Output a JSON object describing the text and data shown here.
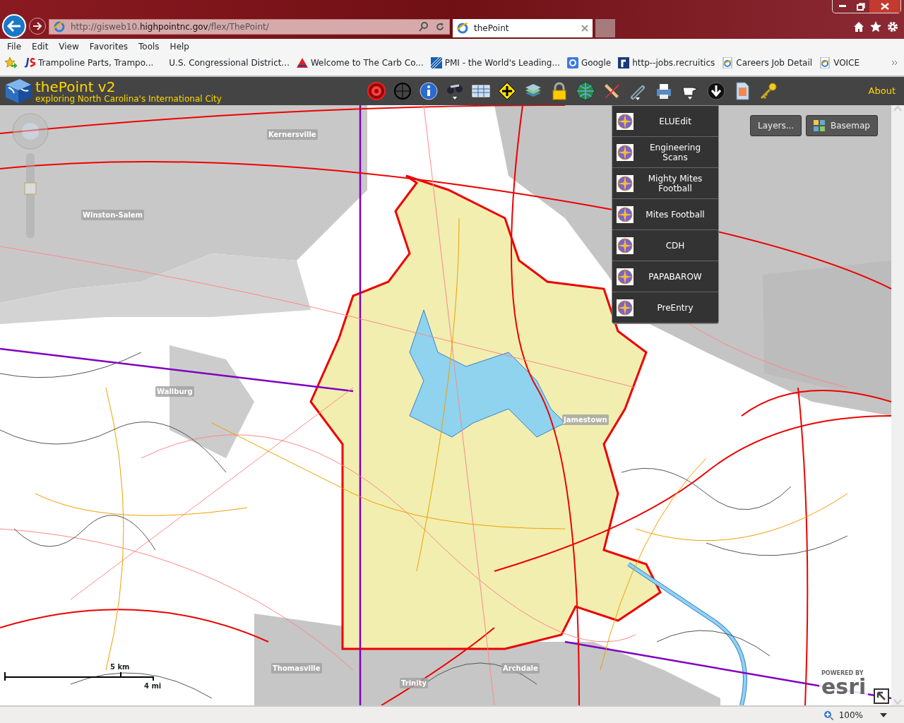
{
  "browser": {
    "address": "http://gisweb10.highpointnc.gov/flex/ThePoint/",
    "tab": "thePoint",
    "menu": [
      "File",
      "Edit",
      "View",
      "Favorites",
      "Tools",
      "Help"
    ],
    "favorites": [
      {
        "label": "Trampoline Parts, Trampo...",
        "kind": "js"
      },
      {
        "label": "U.S. Congressional District...",
        "kind": "none"
      },
      {
        "label": "Welcome to The Carb Co...",
        "kind": "carb"
      },
      {
        "label": "PMI - the World's Leading...",
        "kind": "pmi"
      },
      {
        "label": "Google",
        "kind": "google"
      },
      {
        "label": "http--jobs.recruitics",
        "kind": "r"
      },
      {
        "label": "Careers  Job Detail",
        "kind": "ie"
      },
      {
        "label": "VOICE",
        "kind": "ie"
      }
    ]
  },
  "app": {
    "title": "thePoint v2",
    "subtitle": "exploring North Carolina's International City",
    "about": "About",
    "widget_menu": [
      "ELUEdit",
      "Engineering Scans",
      "Mighty Mites Football",
      "Mites Football",
      "CDH",
      "PAPABAROW",
      "PreEntry"
    ],
    "map_buttons": [
      "Layers...",
      "Basemap"
    ],
    "places": [
      "Kernersville",
      "Winston-Salem",
      "Wallburg",
      "Jamestown",
      "Thomasville",
      "Archdale",
      "Trinity"
    ],
    "scale": {
      "km": "5 km",
      "mi": "4 mi"
    },
    "logo": {
      "powered": "POWERED BY",
      "name": "esri"
    }
  },
  "status_bar": {
    "zoom": "100%"
  }
}
